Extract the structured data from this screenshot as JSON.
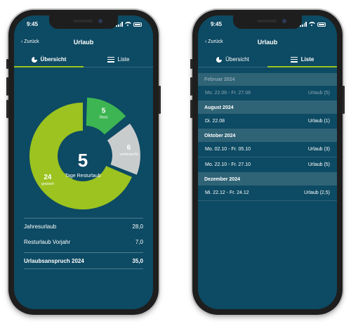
{
  "status": {
    "time": "9:45"
  },
  "nav": {
    "back_label": "Zurück",
    "title": "Urlaub"
  },
  "tabs": [
    {
      "label": "Übersicht",
      "icon": "pie-chart-icon"
    },
    {
      "label": "Liste",
      "icon": "list-icon"
    }
  ],
  "colors": {
    "background": "#0d4a63",
    "planned": "#9cc31f",
    "remaining": "#3db552",
    "used": "#c9cccd",
    "accent": "#9cc31f"
  },
  "overview": {
    "center_value": "5",
    "center_label": "Tage Resturlaub",
    "summary": [
      {
        "label": "Jahresurlaub",
        "value": "28,0"
      },
      {
        "label": "Resturlaub Vorjahr",
        "value": "7,0"
      }
    ],
    "total": {
      "label": "Urlaubsanspruch 2024",
      "value": "35,0"
    }
  },
  "chart_data": {
    "type": "pie",
    "slices": [
      {
        "label": "geplant",
        "value": 24,
        "display": "24"
      },
      {
        "label": "Rest",
        "value": 5,
        "display": "5"
      },
      {
        "label": "verbraucht",
        "value": 6,
        "display": "6"
      }
    ]
  },
  "list": {
    "sections": [
      {
        "header": "Februar 2024",
        "faded": true,
        "rows": [
          {
            "date": "Mo. 22.06  -  Fr. 27.06",
            "info": "Urlaub  (5)"
          }
        ]
      },
      {
        "header": "August 2024",
        "faded": false,
        "rows": [
          {
            "date": "Di. 22.08",
            "info": "Urlaub  (1)"
          }
        ]
      },
      {
        "header": "Oktober 2024",
        "faded": false,
        "rows": [
          {
            "date": "Mo. 02.10  -  Fr. 05.10",
            "info": "Urlaub  (3)"
          },
          {
            "date": "Mo. 22.10  -  Fr. 27.10",
            "info": "Urlaub  (5)"
          }
        ]
      },
      {
        "header": "Dezember 2024",
        "faded": false,
        "rows": [
          {
            "date": "Mi. 22.12  -  Fr. 24.12",
            "info": "Urlaub  (2,5)"
          }
        ]
      }
    ]
  }
}
